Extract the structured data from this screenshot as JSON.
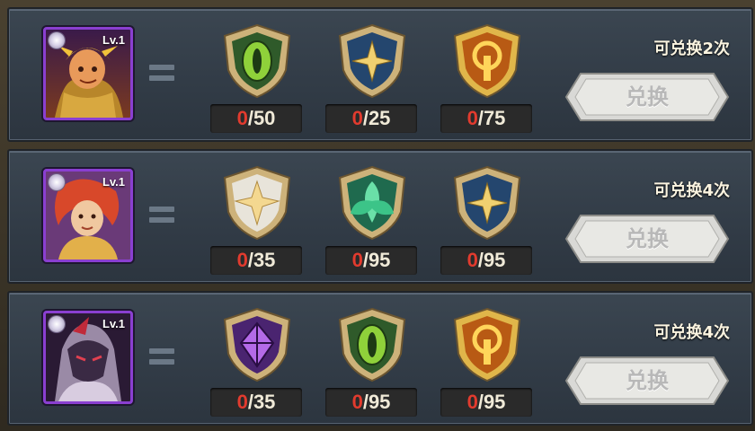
{
  "rows": [
    {
      "hero": {
        "level": "Lv.1",
        "portrait": "hero-monkey-king"
      },
      "items": [
        {
          "icon": "green-eye-emblem",
          "have": "0",
          "need": "/50"
        },
        {
          "icon": "blue-star-emblem",
          "have": "0",
          "need": "/25"
        },
        {
          "icon": "orange-sun-emblem",
          "have": "0",
          "need": "/75"
        }
      ],
      "limit": "可兑换2次",
      "button": "兑换"
    },
    {
      "hero": {
        "level": "Lv.1",
        "portrait": "hero-red-hair"
      },
      "items": [
        {
          "icon": "white-star-emblem",
          "have": "0",
          "need": "/35"
        },
        {
          "icon": "green-leaf-emblem",
          "have": "0",
          "need": "/95"
        },
        {
          "icon": "blue-star-emblem",
          "have": "0",
          "need": "/95"
        }
      ],
      "limit": "可兑换4次",
      "button": "兑换"
    },
    {
      "hero": {
        "level": "Lv.1",
        "portrait": "hero-dark-knight"
      },
      "items": [
        {
          "icon": "purple-crystal-emblem",
          "have": "0",
          "need": "/35"
        },
        {
          "icon": "green-eye-emblem",
          "have": "0",
          "need": "/95"
        },
        {
          "icon": "orange-sun-emblem",
          "have": "0",
          "need": "/95"
        }
      ],
      "limit": "可兑换4次",
      "button": "兑换"
    }
  ],
  "colors": {
    "have_count": "#e23b2e",
    "portrait_border": "#8a3fd1",
    "panel": "#343e49"
  }
}
